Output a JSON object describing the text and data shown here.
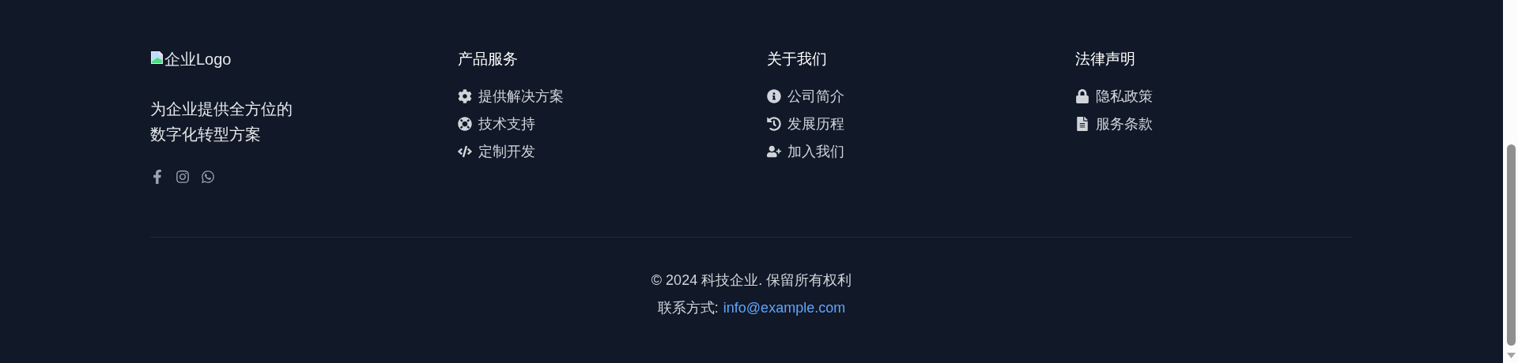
{
  "brand": {
    "logo_alt": "企业Logo",
    "tagline_lines": [
      "为企业提供全方位的",
      "数字化转型方案"
    ]
  },
  "columns": [
    {
      "heading": "产品服务",
      "links": [
        "提供解决方案",
        "技术支持",
        "定制开发"
      ]
    },
    {
      "heading": "关于我们",
      "links": [
        "公司简介",
        "发展历程",
        "加入我们"
      ]
    },
    {
      "heading": "法律声明",
      "links": [
        "隐私政策",
        "服务条款"
      ]
    }
  ],
  "copyright": "© 2024 科技企业. 保留所有权利",
  "contact": {
    "label": "联系方式:",
    "email": "info@example.com"
  }
}
